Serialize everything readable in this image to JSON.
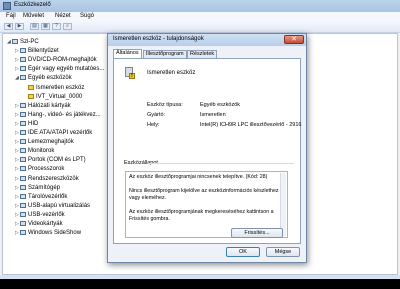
{
  "outer": {
    "title": "Eszközkezelő",
    "menus": [
      "Fájl",
      "Művelet",
      "Nézet",
      "Súgó"
    ]
  },
  "tree": {
    "items": [
      {
        "label": "Szl-PC",
        "level": 0,
        "expander": "◢",
        "icon": "computer-icon"
      },
      {
        "label": "Billentyűzet",
        "level": 1,
        "expander": "▷",
        "icon": "keyboard-icon"
      },
      {
        "label": "DVD/CD-ROM-meghajtók",
        "level": 1,
        "expander": "▷",
        "icon": "disc-drive-icon"
      },
      {
        "label": "Egér vagy egyéb mutatóes...",
        "level": 1,
        "expander": "▷",
        "icon": "mouse-icon"
      },
      {
        "label": "Egyéb eszközök",
        "level": 1,
        "expander": "◢",
        "icon": "other-devices-icon"
      },
      {
        "label": "Ismeretlen eszköz",
        "level": 2,
        "expander": "",
        "icon": "warning-device-icon"
      },
      {
        "label": "IVT_Virtual_0000",
        "level": 2,
        "expander": "",
        "icon": "warning-device-icon"
      },
      {
        "label": "Hálózati kártyák",
        "level": 1,
        "expander": "▷",
        "icon": "network-card-icon"
      },
      {
        "label": "Hang-, videó- és játékvez...",
        "level": 1,
        "expander": "▷",
        "icon": "sound-icon"
      },
      {
        "label": "HID",
        "level": 1,
        "expander": "▷",
        "icon": "hid-icon"
      },
      {
        "label": "IDE ATA/ATAPI vezérlők",
        "level": 1,
        "expander": "▷",
        "icon": "ide-icon"
      },
      {
        "label": "Lemezmeghajtók",
        "level": 1,
        "expander": "▷",
        "icon": "disk-icon"
      },
      {
        "label": "Monitorok",
        "level": 1,
        "expander": "▷",
        "icon": "monitor-icon"
      },
      {
        "label": "Portok (COM és LPT)",
        "level": 1,
        "expander": "▷",
        "icon": "port-icon"
      },
      {
        "label": "Processzorok",
        "level": 1,
        "expander": "▷",
        "icon": "processor-icon"
      },
      {
        "label": "Rendszereszközök",
        "level": 1,
        "expander": "▷",
        "icon": "system-device-icon"
      },
      {
        "label": "Számítógép",
        "level": 1,
        "expander": "▷",
        "icon": "computer-icon"
      },
      {
        "label": "Tárolóvezérlők",
        "level": 1,
        "expander": "▷",
        "icon": "storage-icon"
      },
      {
        "label": "USB-alapú virtualizálás",
        "level": 1,
        "expander": "▷",
        "icon": "usb-icon"
      },
      {
        "label": "USB-vezérlők",
        "level": 1,
        "expander": "▷",
        "icon": "usb-icon"
      },
      {
        "label": "Videokártyák",
        "level": 1,
        "expander": "▷",
        "icon": "video-card-icon"
      },
      {
        "label": "Windows SideShow",
        "level": 1,
        "expander": "▷",
        "icon": "sideshow-icon"
      }
    ]
  },
  "dialog": {
    "title": "Ismeretlen eszköz - tulajdonságok",
    "close": "✕",
    "tabs": [
      "Általános",
      "Illesztőprogram",
      "Részletek"
    ],
    "device_name": "Ismeretlen eszköz",
    "props": [
      {
        "label": "Eszköz típusa:",
        "value": "Egyéb eszközök"
      },
      {
        "label": "Gyártó:",
        "value": "Ismeretlen"
      },
      {
        "label": "Hely:",
        "value": "Intel(R) ICH9R LPC illesztővezérlő - 2916"
      }
    ],
    "status_group": "Eszközállapot",
    "status_text": "Az eszköz illesztőprogramjai nincsenek telepítve. (Kód: 28)\n\nNincs illesztőprogram kijelölve az eszközinformációs készlethez vagy eleméhez.\n\nAz eszköz illesztőprogramjának megkereséséhez kattintson a Frissítés gombra.",
    "refresh": "Frissítés...",
    "ok": "OK",
    "cancel": "Mégse"
  },
  "colors": {
    "accent": "#3c7fb1",
    "warning": "#f1c232"
  }
}
